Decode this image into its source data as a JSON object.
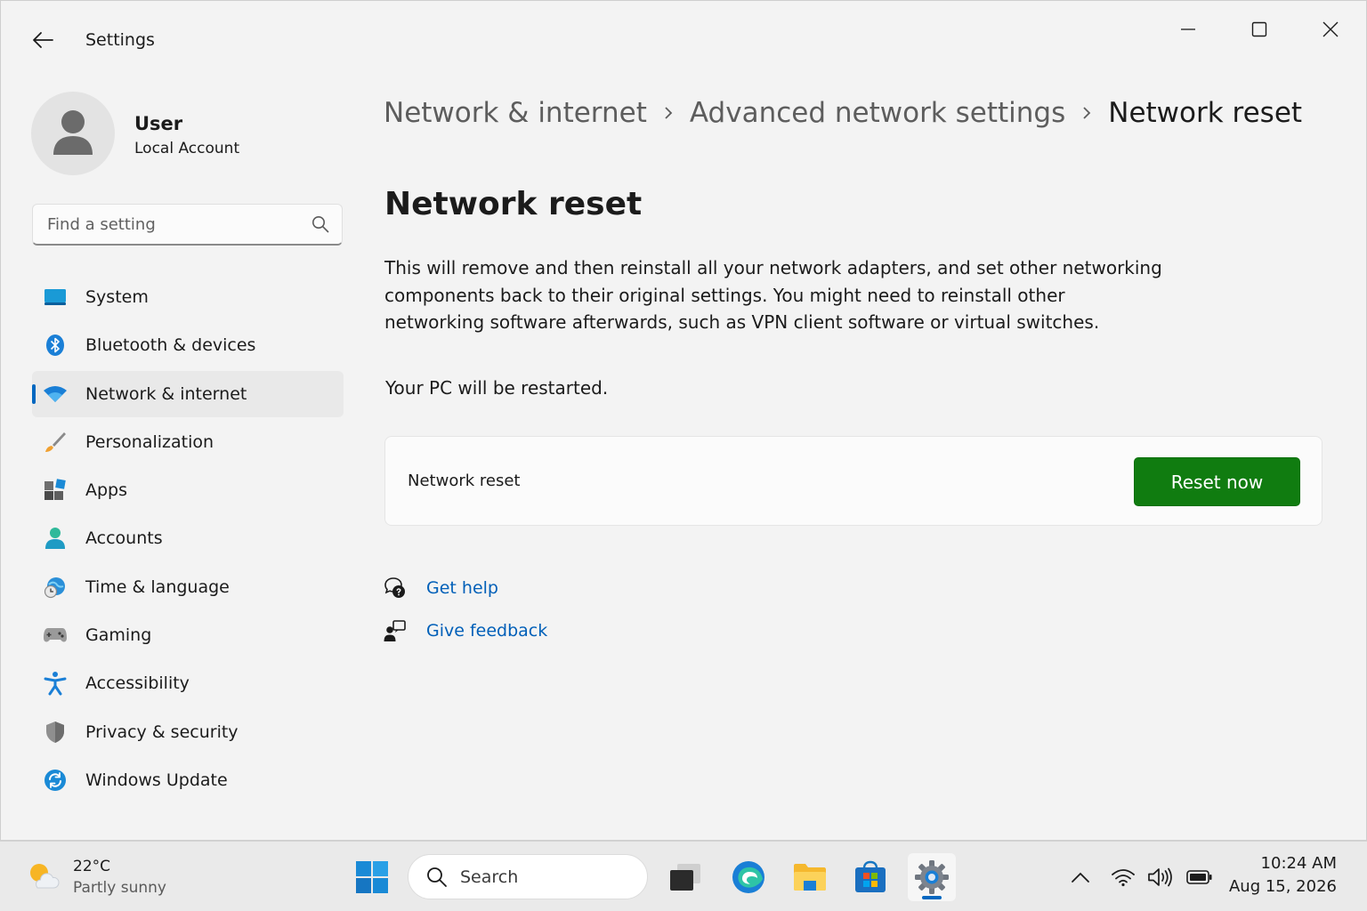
{
  "window": {
    "title": "Settings",
    "controls": {
      "minimize": "minimize-icon",
      "maximize": "maximize-icon",
      "close": "close-icon"
    }
  },
  "profile": {
    "name": "User",
    "account_type": "Local Account"
  },
  "search": {
    "placeholder": "Find a setting"
  },
  "nav": {
    "items": [
      {
        "label": "System",
        "icon": "system-icon"
      },
      {
        "label": "Bluetooth & devices",
        "icon": "bluetooth-icon"
      },
      {
        "label": "Network & internet",
        "icon": "wifi-icon",
        "active": true
      },
      {
        "label": "Personalization",
        "icon": "brush-icon"
      },
      {
        "label": "Apps",
        "icon": "apps-icon"
      },
      {
        "label": "Accounts",
        "icon": "accounts-icon"
      },
      {
        "label": "Time & language",
        "icon": "time-language-icon"
      },
      {
        "label": "Gaming",
        "icon": "gamepad-icon"
      },
      {
        "label": "Accessibility",
        "icon": "accessibility-icon"
      },
      {
        "label": "Privacy & security",
        "icon": "shield-icon"
      },
      {
        "label": "Windows Update",
        "icon": "update-icon"
      }
    ]
  },
  "breadcrumb": {
    "items": [
      "Network & internet",
      "Advanced network settings",
      "Network reset"
    ]
  },
  "main": {
    "title": "Network reset",
    "description": "This will remove and then reinstall all your network adapters, and set other networking components back to their original settings. You might need to reinstall other networking software afterwards, such as VPN client software or virtual switches.",
    "restart_note": "Your PC will be restarted.",
    "card": {
      "label": "Network reset",
      "button": "Reset now"
    },
    "links": {
      "help": "Get help",
      "feedback": "Give feedback"
    }
  },
  "taskbar": {
    "weather": {
      "temp": "22°C",
      "condition": "Partly sunny"
    },
    "search_label": "Search",
    "clock": {
      "time": "10:24 AM",
      "date": "Aug 15, 2026"
    }
  },
  "colors": {
    "accent": "#0067c0",
    "button_green": "#107c10",
    "link": "#005fb8"
  }
}
